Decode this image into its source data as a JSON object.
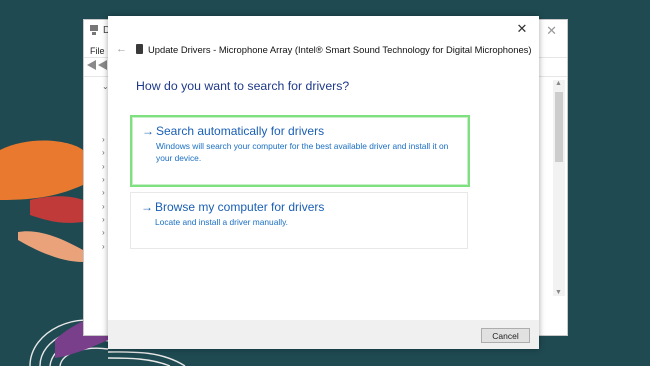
{
  "background_window": {
    "title": "D",
    "close_glyph": "✕",
    "menu_file": "File",
    "tree_glyphs": [
      "⌄",
      "",
      "",
      "",
      "›",
      "›",
      "›",
      "›",
      "›",
      "›",
      "›",
      "›",
      "›"
    ]
  },
  "dialog": {
    "back_glyph": "←",
    "title": "Update Drivers - Microphone Array (Intel® Smart Sound Technology for Digital Microphones)",
    "close_glyph": "✕",
    "heading": "How do you want to search for drivers?",
    "options": [
      {
        "arrow": "→",
        "title": "Search automatically for drivers",
        "description": "Windows will search your computer for the best available driver and install it on your device."
      },
      {
        "arrow": "→",
        "title": "Browse my computer for drivers",
        "description": "Locate and install a driver manually."
      }
    ],
    "cancel_label": "Cancel"
  },
  "colors": {
    "link_blue": "#1a5fb4",
    "heading_blue": "#1f3a8a",
    "highlight_green": "#7ee07e",
    "wallpaper_teal": "#1f4a52"
  }
}
